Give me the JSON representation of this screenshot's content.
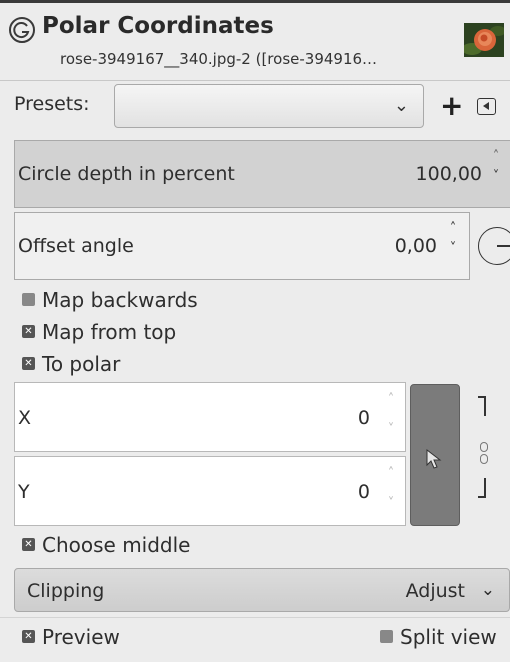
{
  "header": {
    "title": "Polar Coordinates",
    "subtitle": "rose-3949167__340.jpg-2 ([rose-394916…"
  },
  "presets": {
    "label": "Presets:",
    "value": ""
  },
  "circle_depth": {
    "label": "Circle depth in percent",
    "value": "100,00"
  },
  "offset_angle": {
    "label": "Offset angle",
    "value": "0,00"
  },
  "checkboxes": {
    "map_backwards": {
      "label": "Map backwards",
      "checked": false
    },
    "map_from_top": {
      "label": "Map from top",
      "checked": true
    },
    "to_polar": {
      "label": "To polar",
      "checked": true
    },
    "choose_middle": {
      "label": "Choose middle",
      "checked": true
    },
    "preview": {
      "label": "Preview",
      "checked": true
    },
    "split_view": {
      "label": "Split view",
      "checked": false
    }
  },
  "center": {
    "x_label": "X",
    "x_value": "0",
    "y_label": "Y",
    "y_value": "0"
  },
  "clipping": {
    "label": "Clipping",
    "value": "Adjust"
  }
}
